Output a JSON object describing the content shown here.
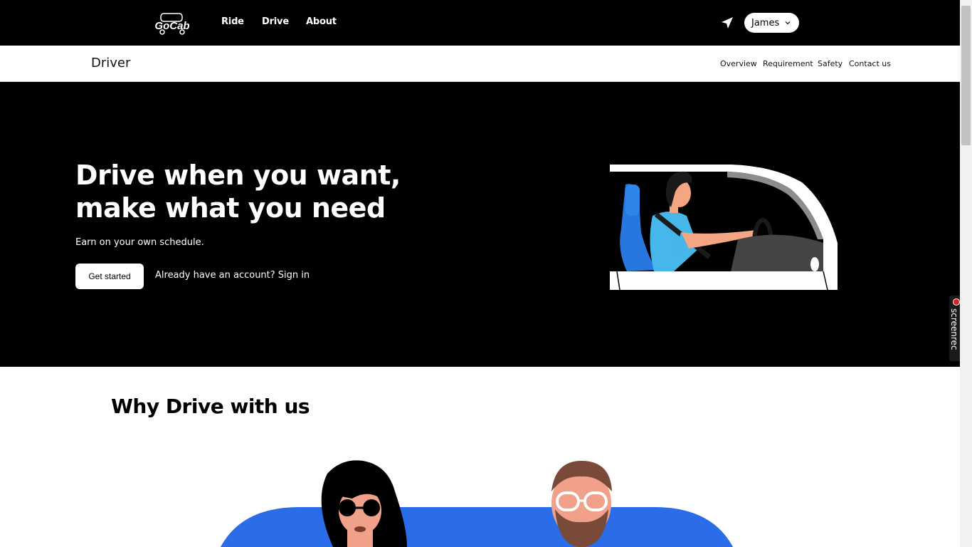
{
  "brand": {
    "logo_text": "GoCab"
  },
  "topnav": {
    "links": [
      "Ride",
      "Drive",
      "About"
    ],
    "location_icon": "navigation-arrow-icon",
    "user": {
      "name": "James",
      "icon": "chevron-down-icon"
    }
  },
  "subnav": {
    "title": "Driver",
    "links": [
      "Overview",
      "Requirement",
      "Safety",
      "Contact us"
    ]
  },
  "hero": {
    "title": "Drive when you want, make what you need",
    "subtitle": "Earn on your own schedule.",
    "cta_label": "Get started",
    "signin_text": "Already have an account? Sign in",
    "illustration": "driver-in-car-illustration"
  },
  "why": {
    "title": "Why Drive with us",
    "illustration": "two-people-illustration"
  },
  "overlay": {
    "recorder_label": "screenrec"
  },
  "colors": {
    "nav_bg": "#000000",
    "hero_bg": "#000000",
    "accent_blue": "#2b6de8",
    "driver_shirt": "#47b6ea"
  }
}
